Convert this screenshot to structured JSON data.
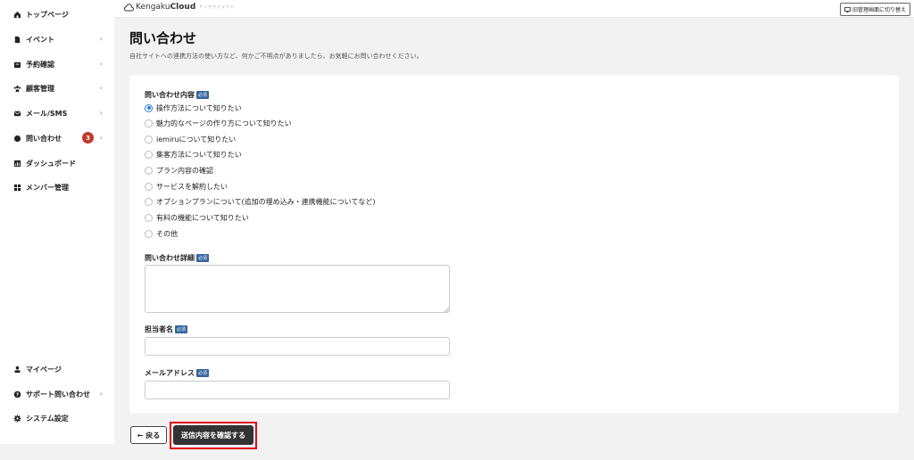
{
  "sidebar": {
    "items": [
      {
        "label": "トップページ",
        "icon": "home-icon",
        "chevron": ""
      },
      {
        "label": "イベント",
        "icon": "document-icon",
        "chevron": "›"
      },
      {
        "label": "予約確認",
        "icon": "inbox-icon",
        "chevron": "›"
      },
      {
        "label": "顧客管理",
        "icon": "users-icon",
        "chevron": "›"
      },
      {
        "label": "メール/SMS",
        "icon": "mail-icon",
        "chevron": "›"
      },
      {
        "label": "問い合わせ",
        "icon": "chat-icon",
        "chevron": "›",
        "badge": "3"
      },
      {
        "label": "ダッシュボード",
        "icon": "chart-icon",
        "chevron": ""
      },
      {
        "label": "メンバー管理",
        "icon": "grid-icon",
        "chevron": ""
      }
    ],
    "bottom_items": [
      {
        "label": "マイページ",
        "icon": "person-icon",
        "chevron": ""
      },
      {
        "label": "サポート問い合わせ",
        "icon": "help-icon",
        "chevron": "›"
      },
      {
        "label": "システム設定",
        "icon": "gear-icon",
        "chevron": ""
      }
    ]
  },
  "header": {
    "logo_light": "Kengaku",
    "logo_bold": "Cloud",
    "logo_sub": "ケンガククラウド",
    "switch_label": "旧管理画面に切り替え"
  },
  "page": {
    "title": "問い合わせ",
    "description": "自社サイトへの連携方法の使い方など、何かご不明点がありましたら、お気軽にお問い合わせください。"
  },
  "form": {
    "required_badge": "必須",
    "content_label": "問い合わせ内容",
    "options": [
      "操作方法について知りたい",
      "魅力的なページの作り方について知りたい",
      "iemiruについて知りたい",
      "集客方法について知りたい",
      "プラン内容の確認",
      "サービスを解約したい",
      "オプションプランについて(追加の埋め込み・連携機能についてなど)",
      "有料の機能について知りたい",
      "その他"
    ],
    "selected_option": "操作方法について知りたい",
    "detail_label": "問い合わせ詳細",
    "detail_value": "",
    "name_label": "担当者名",
    "name_value": "",
    "email_label": "メールアドレス",
    "email_value": ""
  },
  "actions": {
    "back_label": "← 戻る",
    "submit_label": "送信内容を確認する"
  },
  "colors": {
    "highlight": "#e3001b",
    "badge": "#c0392b",
    "required": "#35649b",
    "radio_selected": "#2c7be5"
  }
}
